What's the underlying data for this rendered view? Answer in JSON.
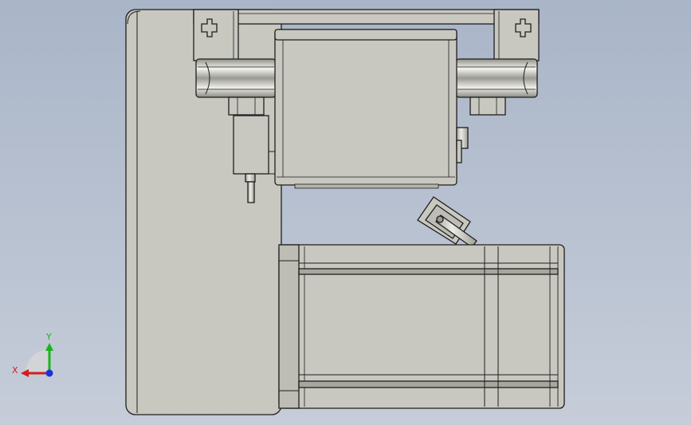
{
  "viewport": {
    "background_top": "#a9b5c8",
    "background_bottom": "#c6cdd9"
  },
  "model": {
    "body_color": "#c8c8c0",
    "edge_color": "#1e1e1e",
    "shade_color": "#a7a79f"
  },
  "triad": {
    "x_label": "X",
    "y_label": "Y",
    "x_color": "#d21e1e",
    "y_color": "#19b419",
    "z_color": "#1f2fd6"
  }
}
